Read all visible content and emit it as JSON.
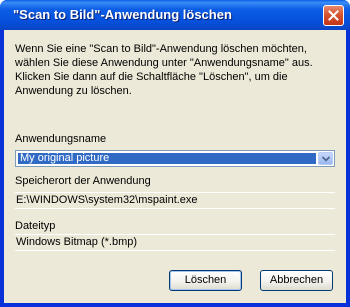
{
  "window": {
    "title": "\"Scan to Bild\"-Anwendung löschen"
  },
  "description": "Wenn Sie eine \"Scan to Bild\"-Anwendung löschen möchten, wählen Sie diese Anwendung unter \"Anwendungsname\" aus. Klicken Sie dann auf die Schaltfläche \"Löschen\", um die Anwendung zu löschen.",
  "app_name": {
    "label": "Anwendungsname",
    "selected": "My original picture"
  },
  "location": {
    "label": "Speicherort der Anwendung",
    "value": "E:\\WINDOWS\\system32\\mspaint.exe"
  },
  "filetype": {
    "label": "Dateityp",
    "value": "Windows Bitmap (*.bmp)"
  },
  "buttons": {
    "delete": "Löschen",
    "cancel": "Abbrechen"
  }
}
